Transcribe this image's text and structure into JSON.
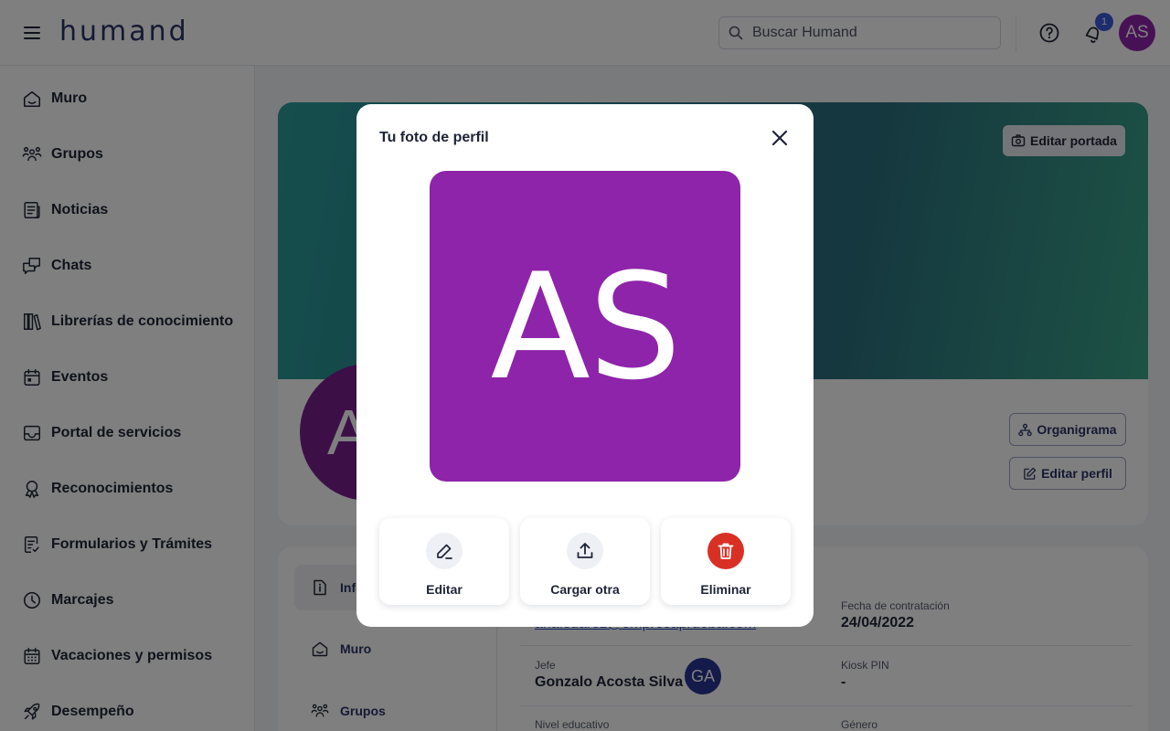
{
  "brand": {
    "logo_text": "humand"
  },
  "header": {
    "search_placeholder": "Buscar Humand",
    "notification_count": "1",
    "user_initials": "AS"
  },
  "sidebar": {
    "items": [
      {
        "label": "Muro",
        "icon": "home-icon"
      },
      {
        "label": "Grupos",
        "icon": "groups-icon"
      },
      {
        "label": "Noticias",
        "icon": "news-icon"
      },
      {
        "label": "Chats",
        "icon": "chat-icon"
      },
      {
        "label": "Librerías de conocimiento",
        "icon": "library-icon"
      },
      {
        "label": "Eventos",
        "icon": "calendar-icon"
      },
      {
        "label": "Portal de servicios",
        "icon": "inbox-icon"
      },
      {
        "label": "Reconocimientos",
        "icon": "award-icon"
      },
      {
        "label": "Formularios y Trámites",
        "icon": "form-icon"
      },
      {
        "label": "Marcajes",
        "icon": "clock-icon"
      },
      {
        "label": "Vacaciones y permisos",
        "icon": "calendar-grid-icon"
      },
      {
        "label": "Desempeño",
        "icon": "rocket-icon"
      }
    ]
  },
  "profile": {
    "edit_cover_label": "Editar portada",
    "avatar_initials": "AS",
    "org_chart_label": "Organigrama",
    "edit_profile_label": "Editar perfil",
    "tabs": [
      {
        "label": "Info",
        "icon": "info-icon"
      },
      {
        "label": "Muro",
        "icon": "home-icon"
      },
      {
        "label": "Grupos",
        "icon": "groups-icon"
      }
    ],
    "email_partial": "ana.suarez@empresaprueba.com",
    "fields": {
      "hire_date": {
        "label": "Fecha de contratación",
        "value": "24/04/2022"
      },
      "boss": {
        "label": "Jefe",
        "value": "Gonzalo Acosta Silva",
        "initials": "GA"
      },
      "kiosk_pin": {
        "label": "Kiosk PIN",
        "value": "-"
      },
      "education": {
        "label": "Nivel educativo",
        "value": ""
      },
      "gender": {
        "label": "Género",
        "value": ""
      }
    }
  },
  "modal": {
    "title": "Tu foto de perfil",
    "photo_initials": "AS",
    "photo_color": "#8e24aa",
    "actions": [
      {
        "label": "Editar",
        "icon": "edit-pen-icon"
      },
      {
        "label": "Cargar otra",
        "icon": "upload-icon"
      },
      {
        "label": "Eliminar",
        "icon": "trash-icon",
        "color": "#d93025"
      }
    ]
  }
}
